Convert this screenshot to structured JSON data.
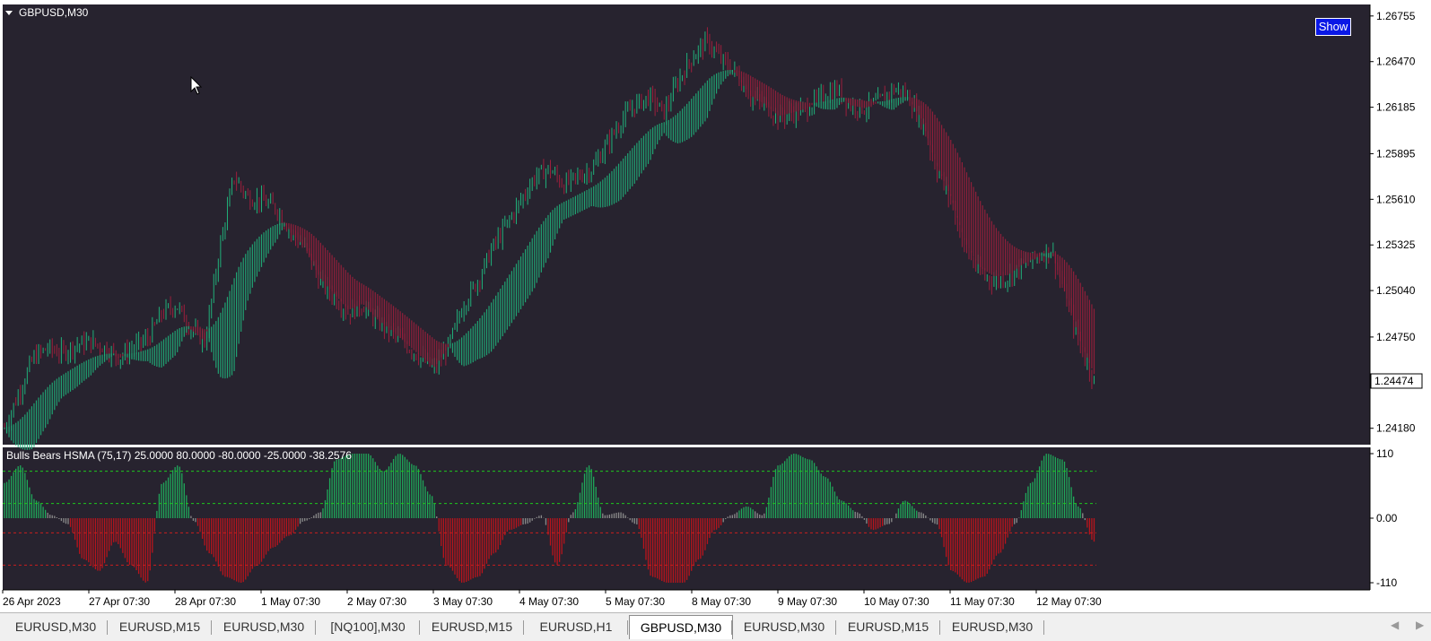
{
  "window": {
    "symbol_title": "GBPUSD,M30"
  },
  "show_button": {
    "label": "Show"
  },
  "price_axis": {
    "ticks": [
      "1.26755",
      "1.26470",
      "1.26185",
      "1.25895",
      "1.25610",
      "1.25325",
      "1.25040",
      "1.24750",
      "1.24474",
      "1.24180"
    ],
    "current_price": "1.24474"
  },
  "indicator": {
    "title": "Bulls Bears HSMA (75,17) 25.0000 80.0000 -80.0000 -25.0000 -38.2576",
    "ticks": [
      "110",
      "0.00",
      "-110"
    ]
  },
  "time_axis": {
    "labels": [
      "26 Apr 2023",
      "27 Apr 07:30",
      "28 Apr 07:30",
      "1 May 07:30",
      "2 May 07:30",
      "3 May 07:30",
      "4 May 07:30",
      "5 May 07:30",
      "8 May 07:30",
      "9 May 07:30",
      "10 May 07:30",
      "11 May 07:30",
      "12 May 07:30"
    ]
  },
  "tabs": [
    {
      "label": "EURUSD,M30",
      "active": false
    },
    {
      "label": "EURUSD,M15",
      "active": false
    },
    {
      "label": "EURUSD,M30",
      "active": false
    },
    {
      "label": "[NQ100],M30",
      "active": false
    },
    {
      "label": "EURUSD,M15",
      "active": false
    },
    {
      "label": "EURUSD,H1",
      "active": false
    },
    {
      "label": "GBPUSD,M30",
      "active": true
    },
    {
      "label": "EURUSD,M30",
      "active": false
    },
    {
      "label": "EURUSD,M15",
      "active": false
    },
    {
      "label": "EURUSD,M30",
      "active": false
    }
  ],
  "colors": {
    "chart_bg": "#27232f",
    "bull": "#20b07a",
    "bear": "#9c1f3c",
    "hist_bull": "#1fa85a",
    "hist_bear": "#b8141c",
    "neutral": "#8a8a8a",
    "level_green": "#1ec81e",
    "level_red": "#c81e1e"
  },
  "chart_data": [
    {
      "type": "line",
      "title": "GBPUSD,M30",
      "series": [
        {
          "values": [
            1.2418,
            1.244,
            1.2462,
            1.2468,
            1.2465,
            1.247,
            1.2472,
            1.2468,
            1.2462,
            1.2468,
            1.2474,
            1.249,
            1.2495,
            1.248,
            1.2472,
            1.253,
            1.2575,
            1.2562,
            1.256,
            1.2555,
            1.254,
            1.253,
            1.251,
            1.25,
            1.249,
            1.2495,
            1.2485,
            1.2478,
            1.247,
            1.2462,
            1.2455,
            1.247,
            1.2495,
            1.251,
            1.253,
            1.2545,
            1.256,
            1.2575,
            1.258,
            1.257,
            1.2575,
            1.258,
            1.2595,
            1.261,
            1.262,
            1.2625,
            1.2615,
            1.2635,
            1.265,
            1.266,
            1.2648,
            1.264,
            1.2625,
            1.262,
            1.2612,
            1.2615,
            1.2618,
            1.2625,
            1.263,
            1.262,
            1.2618,
            1.2622,
            1.263,
            1.2625,
            1.261,
            1.258,
            1.256,
            1.253,
            1.2515,
            1.251,
            1.2512,
            1.252,
            1.2525,
            1.253,
            1.25,
            1.247,
            1.2448
          ]
        }
      ],
      "ylim": [
        1.241,
        1.2681
      ]
    },
    {
      "type": "bar",
      "title": "Bulls Bears HSMA (75,17) 25.0000 80.0000 -80.0000 -25.0000 -38.2576",
      "values": [
        60,
        90,
        30,
        5,
        -10,
        -70,
        -90,
        -40,
        -80,
        -110,
        60,
        90,
        -5,
        -60,
        -100,
        -110,
        -80,
        -50,
        -30,
        -5,
        10,
        100,
        110,
        110,
        80,
        110,
        90,
        40,
        -80,
        -110,
        -100,
        -60,
        -20,
        -10,
        5,
        -80,
        10,
        90,
        5,
        10,
        -10,
        -100,
        -110,
        -110,
        -70,
        -20,
        5,
        20,
        5,
        90,
        110,
        100,
        70,
        30,
        10,
        -20,
        -10,
        30,
        10,
        -10,
        -90,
        -110,
        -100,
        -60,
        -10,
        60,
        110,
        100,
        20,
        -40
      ],
      "levels": [
        80,
        25,
        -25,
        -80
      ],
      "ylim": [
        -110,
        110
      ]
    }
  ]
}
